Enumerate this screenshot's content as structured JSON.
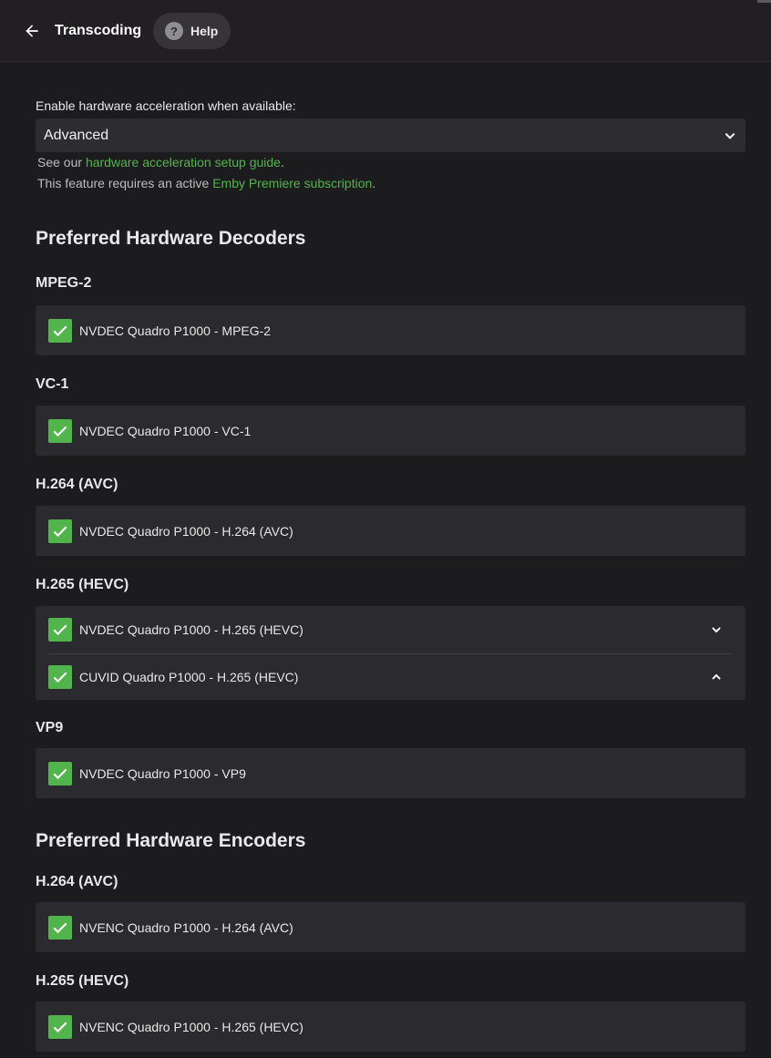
{
  "header": {
    "title": "Transcoding",
    "help_label": "Help",
    "help_glyph": "?"
  },
  "hw_accel": {
    "label": "Enable hardware acceleration when available:",
    "selected": "Advanced",
    "help1_prefix": "See our ",
    "help1_link": "hardware acceleration setup guide",
    "help1_suffix": ".",
    "help2_prefix": "This feature requires an active ",
    "help2_link": "Emby Premiere subscription",
    "help2_suffix": "."
  },
  "decoders": {
    "title": "Preferred Hardware Decoders",
    "mpeg2": {
      "title": "MPEG-2",
      "items": [
        {
          "label": "NVDEC Quadro P1000 - MPEG-2",
          "checked": true
        }
      ]
    },
    "vc1": {
      "title": "VC-1",
      "items": [
        {
          "label": "NVDEC Quadro P1000 - VC-1",
          "checked": true
        }
      ]
    },
    "h264": {
      "title": "H.264 (AVC)",
      "items": [
        {
          "label": "NVDEC Quadro P1000 - H.264 (AVC)",
          "checked": true
        }
      ]
    },
    "h265": {
      "title": "H.265 (HEVC)",
      "items": [
        {
          "label": "NVDEC Quadro P1000 - H.265 (HEVC)",
          "checked": true
        },
        {
          "label": "CUVID Quadro P1000 - H.265 (HEVC)",
          "checked": true
        }
      ]
    },
    "vp9": {
      "title": "VP9",
      "items": [
        {
          "label": "NVDEC Quadro P1000 - VP9",
          "checked": true
        }
      ]
    }
  },
  "encoders": {
    "title": "Preferred Hardware Encoders",
    "h264": {
      "title": "H.264 (AVC)",
      "items": [
        {
          "label": "NVENC Quadro P1000 - H.264 (AVC)",
          "checked": true
        }
      ]
    },
    "h265": {
      "title": "H.265 (HEVC)",
      "items": [
        {
          "label": "NVENC Quadro P1000 - H.265 (HEVC)",
          "checked": true
        }
      ]
    }
  },
  "colors": {
    "accent": "#52b54b",
    "background": "#1c1b1e",
    "card": "#2b2a2e"
  },
  "icons": {
    "back": "arrow-left-icon",
    "help": "help-circle-icon",
    "dropdown": "chevron-down-icon",
    "check": "check-icon",
    "move_down": "chevron-down-icon",
    "move_up": "chevron-up-icon"
  }
}
